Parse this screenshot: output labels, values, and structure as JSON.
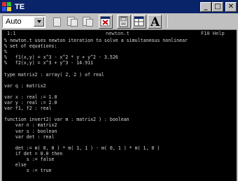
{
  "window": {
    "title": "TE",
    "controls": {
      "minimize": "_",
      "maximize": "□",
      "close": "✕"
    }
  },
  "toolbar": {
    "mode_select": {
      "value": "Auto"
    },
    "buttons": [
      "new-document",
      "copy-document",
      "paste-document",
      "close-document",
      "save",
      "window-layout",
      "font"
    ],
    "font_button_label": "A"
  },
  "status": {
    "position": "1:1",
    "filename": "newton.t",
    "help": "F10 Help"
  },
  "code": [
    "% newton.t uses newton iteration to solve a simultaneous nonlinear",
    "% set of equations:",
    "%",
    "%   f1(x,y) = x^3 - x^2 * y + y^2 - 3.526",
    "%   f2(x,y) = x^3 + y^3 - 14.911",
    "",
    "type matrix2 : array( 2, 2 ) of real",
    "",
    "var q : matrix2",
    "",
    "var x : real := 1.0",
    "var y : real := 2.0",
    "var f1, f2 : real",
    "",
    "function invert2( var m : matrix2 ) : boolean",
    "    var n : matrix2",
    "    var s : boolean",
    "    var det : real",
    "",
    "    det := m( 0, 0 ) * m( 1, 1 ) - m( 0, 1 ) * m( 1, 0 )",
    "    if det = 0.0 then",
    "        s := false",
    "    else",
    "        s := true",
    "        "
  ],
  "colors": {
    "titlebar": "#0a246a",
    "chrome": "#c0c0c0",
    "editor_bg": "#000000",
    "editor_text": "#d8d8d8"
  }
}
